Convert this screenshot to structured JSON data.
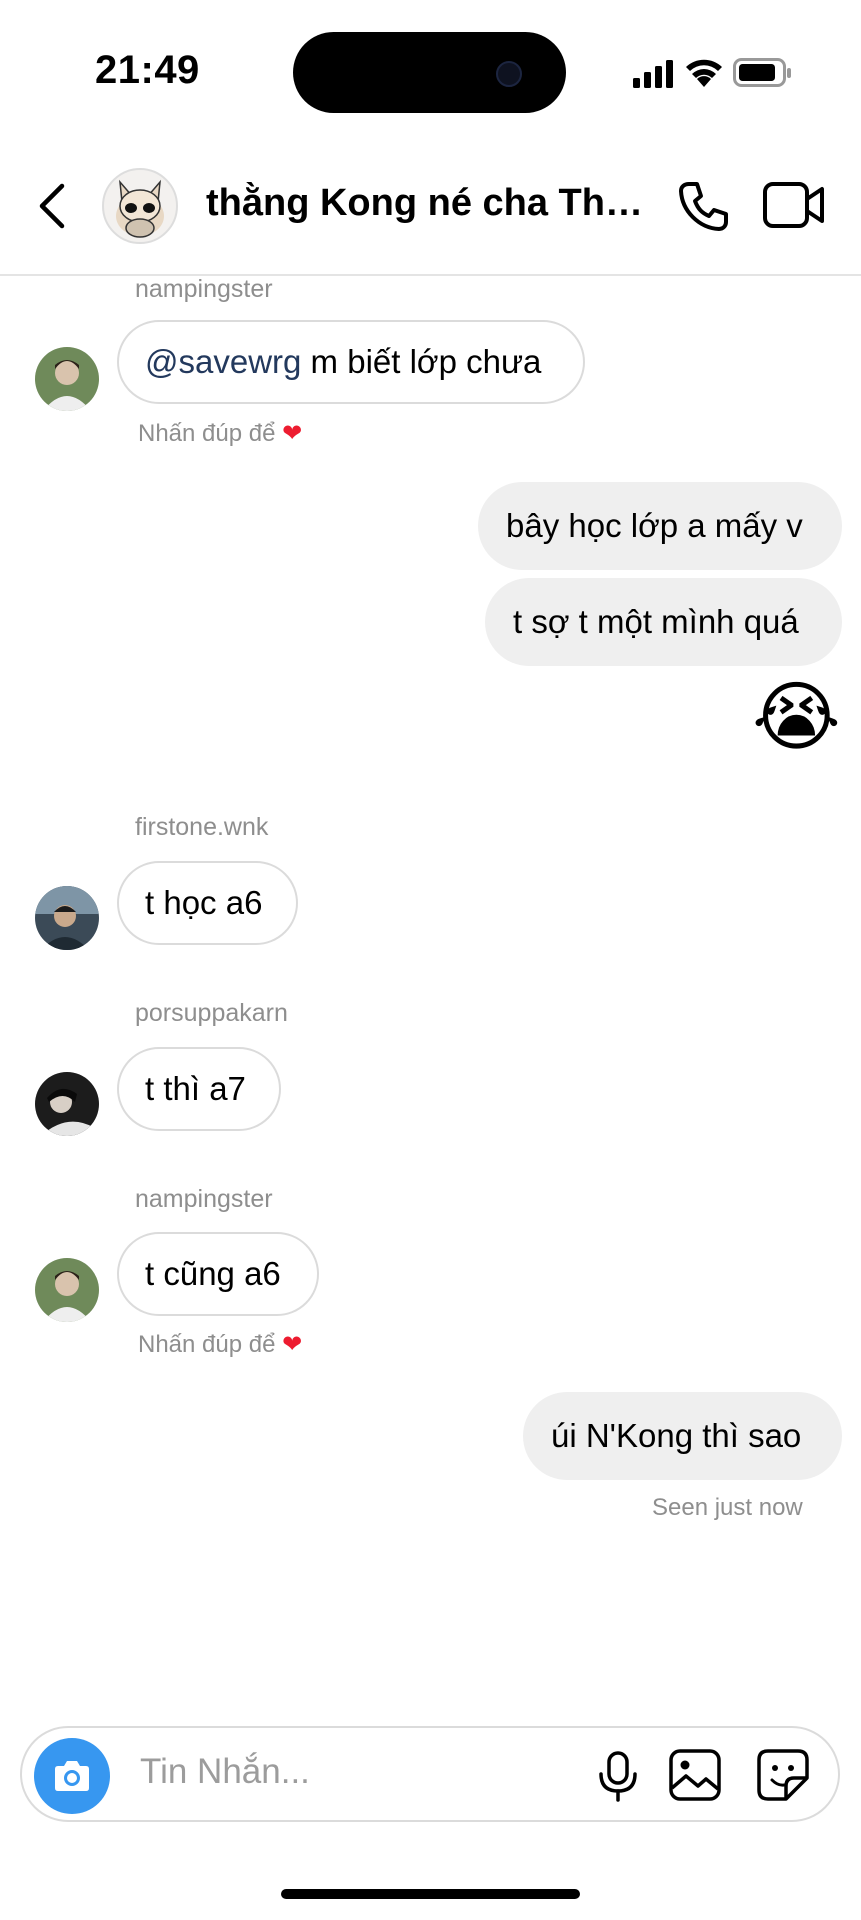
{
  "status_bar": {
    "time": "21:49"
  },
  "header": {
    "title": "thằng Kong né cha Tho..."
  },
  "messages": [
    {
      "sender": "nampingster",
      "mention": "@savewrg",
      "text": " m biết lớp chưa",
      "hint": "Nhấn đúp để"
    },
    {
      "text": "bây học lớp a mấy v"
    },
    {
      "text": "t sợ t một mình quá"
    },
    {
      "emoji": "😭"
    },
    {
      "sender": "firstone.wnk",
      "text": "t học a6"
    },
    {
      "sender": "porsuppakarn",
      "text": "t thì a7"
    },
    {
      "sender": "nampingster",
      "text": "t cũng a6",
      "hint": "Nhấn đúp để"
    },
    {
      "text": "úi N'Kong thì sao"
    }
  ],
  "seen_text": "Seen just now",
  "composer": {
    "placeholder": "Tin Nhắn..."
  },
  "icons": {
    "heart": "heart-icon",
    "camera": "camera-icon",
    "mic": "microphone-icon",
    "gallery": "gallery-icon",
    "sticker": "sticker-icon",
    "phone": "phone-icon",
    "video": "video-icon",
    "back": "back-chevron-icon"
  },
  "colors": {
    "accent_blue": "#3797f0",
    "mention": "#23395d",
    "heart": "#ed1c30",
    "bubble_out": "#efefef",
    "muted_text": "#8e8e8e"
  }
}
